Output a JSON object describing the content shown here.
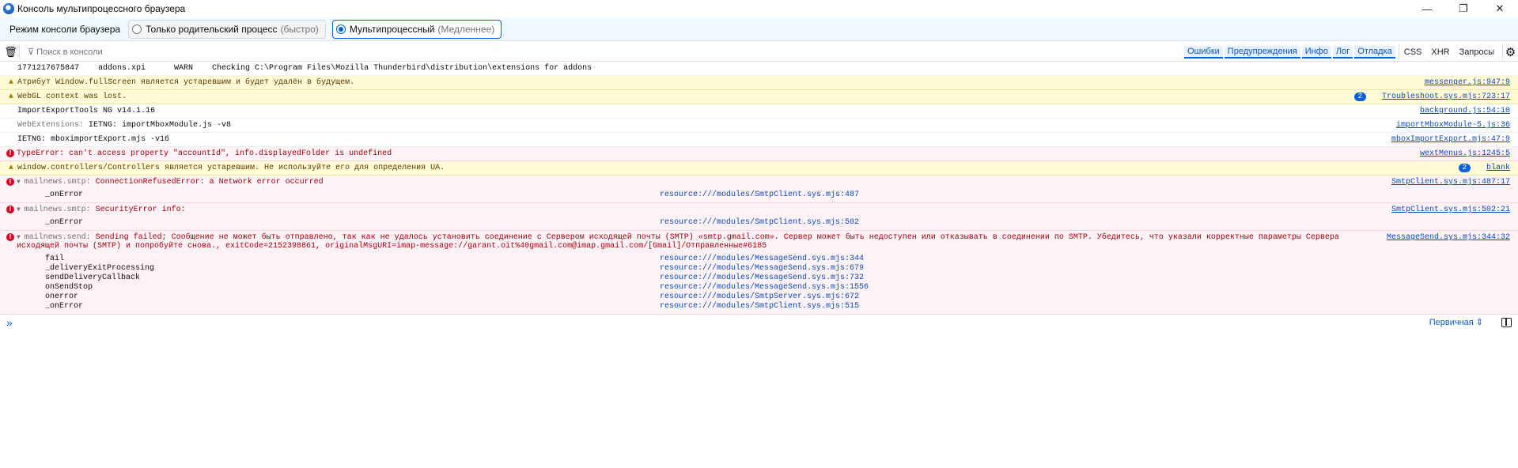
{
  "window": {
    "title": "Консоль мультипроцессного браузера",
    "minimize": "—",
    "restore": "❐",
    "close": "✕"
  },
  "mode": {
    "label": "Режим консоли браузера",
    "options": [
      {
        "label": "Только родительский процесс",
        "hint": "(быстро)",
        "selected": false
      },
      {
        "label": "Мультипроцессный",
        "hint": "(Медленнее)",
        "selected": true
      }
    ]
  },
  "toolbar": {
    "filter_placeholder": "Поиск в консоли",
    "filters": [
      "Ошибки",
      "Предупреждения",
      "Инфо",
      "Лог",
      "Отладка"
    ],
    "net": [
      "CSS",
      "XHR",
      "Запросы"
    ]
  },
  "messages": [
    {
      "type": "log",
      "text": "1771217675847    addons.xpi      WARN    Checking C:\\Program Files\\Mozilla Thunderbird\\distribution\\extensions for addons",
      "source": ""
    },
    {
      "type": "warn",
      "text": "Атрибут Window.fullScreen является устаревшим и будет удалён в будущем.",
      "source": "messenger.js:947:9"
    },
    {
      "type": "warn",
      "text": "WebGL context was lost.",
      "count": "2",
      "source": "Troubleshoot.sys.mjs:723:17"
    },
    {
      "type": "log",
      "text": "ImportExportTools NG v14.1.16",
      "source": "background.js:54:10"
    },
    {
      "type": "log",
      "prefix": "WebExtensions: ",
      "text": "IETNG: importMboxModule.js -v8",
      "source": "importMboxModule-5.js:36"
    },
    {
      "type": "log",
      "text": "IETNG: mboximportExport.mjs -v16",
      "source": "mboxImportExport.mjs:47:9"
    },
    {
      "type": "error",
      "text": "TypeError: can't access property \"accountId\", info.displayedFolder is undefined",
      "source": "wextMenus.js:1245:5"
    },
    {
      "type": "warn",
      "text": "window.controllers/Controllers является устаревшим. Не используйте его для определения UA.",
      "count": "2",
      "source": "blank"
    },
    {
      "type": "error",
      "prefix": "mailnews.smtp: ",
      "text": "ConnectionRefusedError: a Network error occurred",
      "source": "SmtpClient.sys.mjs:487:17",
      "stack": [
        [
          "_onError",
          "resource:///modules/SmtpClient.sys.mjs:487"
        ]
      ]
    },
    {
      "type": "error",
      "prefix": "mailnews.smtp: ",
      "text": "SecurityError info:",
      "source": "SmtpClient.sys.mjs:502:21",
      "stack": [
        [
          "_onError",
          "resource:///modules/SmtpClient.sys.mjs:502"
        ]
      ]
    },
    {
      "type": "error",
      "prefix": "mailnews.send: ",
      "text": "Sending failed; Сообщение не может быть отправлено, так как не удалось установить соединение с Сервером исходящей почты (SMTP) «smtp.gmail.com». Сервер может быть недоступен или отказывать в соединении по SMTP. Убедитесь, что указали корректные параметры Сервера исходящей почты (SMTP) и попробуйте снова., exitCode=2152398861, originalMsgURI=imap-message://garant.oit%40gmail.com@imap.gmail.com/[Gmail]/Отправленные#6185",
      "source": "MessageSend.sys.mjs:344:32",
      "stack": [
        [
          "fail",
          "resource:///modules/MessageSend.sys.mjs:344"
        ],
        [
          "_deliveryExitProcessing",
          "resource:///modules/MessageSend.sys.mjs:679"
        ],
        [
          "sendDeliveryCallback",
          "resource:///modules/MessageSend.sys.mjs:732"
        ],
        [
          "onSendStop",
          "resource:///modules/MessageSend.sys.mjs:1556"
        ],
        [
          "onerror",
          "resource:///modules/SmtpServer.sys.mjs:672"
        ],
        [
          "_onError",
          "resource:///modules/SmtpClient.sys.mjs:515"
        ]
      ]
    }
  ],
  "input": {
    "prompt": "»",
    "editor_mode": "Первичная ⇕"
  }
}
